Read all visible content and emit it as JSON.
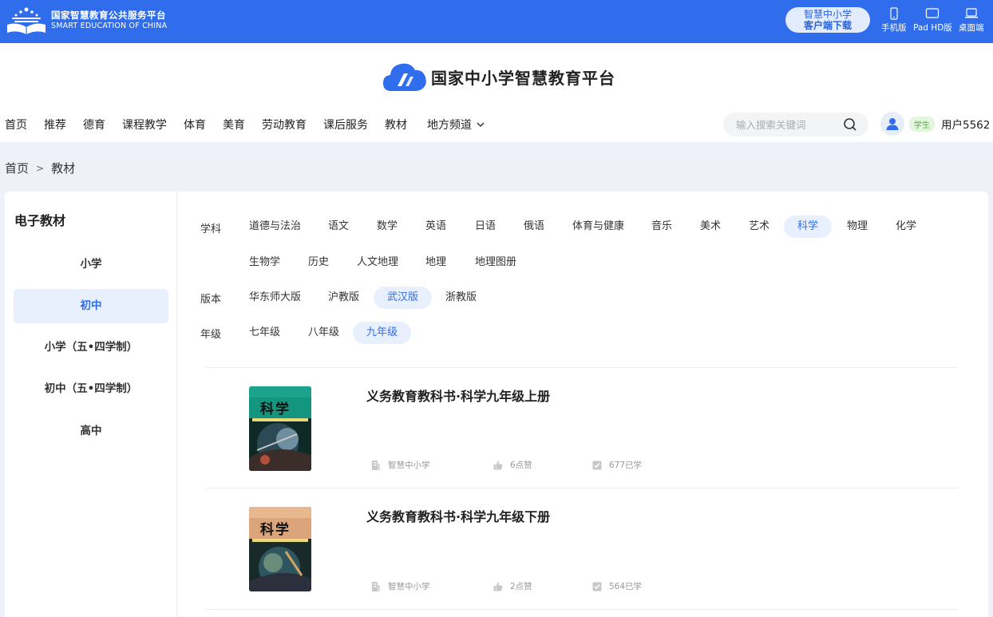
{
  "topbar": {
    "brand_cn": "国家智慧教育公共服务平台",
    "brand_en": "SMART EDUCATION OF CHINA",
    "download_line1": "智慧中小学",
    "download_line2": "客户端下载",
    "devices": [
      {
        "label": "手机版",
        "icon": "phone-icon"
      },
      {
        "label": "Pad HD版",
        "icon": "tablet-icon"
      },
      {
        "label": "桌面端",
        "icon": "laptop-icon"
      }
    ]
  },
  "header": {
    "platform_title": "国家中小学智慧教育平台",
    "nav": [
      "首页",
      "推荐",
      "德育",
      "课程教学",
      "体育",
      "美育",
      "劳动教育",
      "课后服务",
      "教材"
    ],
    "nav_dropdown": "地方频道",
    "search_placeholder": "输入搜索关键词",
    "role_badge": "学生",
    "username": "用户5562"
  },
  "breadcrumb": {
    "home": "首页",
    "sep": ">",
    "current": "教材"
  },
  "sidebar": {
    "title": "电子教材",
    "items": [
      "小学",
      "初中",
      "小学（五•四学制）",
      "初中（五•四学制）",
      "高中"
    ],
    "active_index": 1
  },
  "filters": {
    "subject_label": "学科",
    "subjects": [
      "道德与法治",
      "语文",
      "数学",
      "英语",
      "日语",
      "俄语",
      "体育与健康",
      "音乐",
      "美术",
      "艺术",
      "科学",
      "物理",
      "化学",
      "生物学",
      "历史",
      "人文地理",
      "地理",
      "地理图册"
    ],
    "subject_active": "科学",
    "edition_label": "版本",
    "editions": [
      "华东师大版",
      "沪教版",
      "武汉版",
      "浙教版"
    ],
    "edition_active": "武汉版",
    "grade_label": "年级",
    "grades": [
      "七年级",
      "八年级",
      "九年级"
    ],
    "grade_active": "九年级"
  },
  "books": [
    {
      "title": "义务教育教科书·科学九年级上册",
      "publisher": "智慧中小学",
      "likes": "6点赞",
      "learners": "677已学",
      "cover_text": "科学"
    },
    {
      "title": "义务教育教科书·科学九年级下册",
      "publisher": "智慧中小学",
      "likes": "2点赞",
      "learners": "564已学",
      "cover_text": "科学"
    }
  ],
  "colors": {
    "primary": "#2f6ded",
    "active_bg": "#e8effd",
    "student_badge": "#52b347"
  }
}
